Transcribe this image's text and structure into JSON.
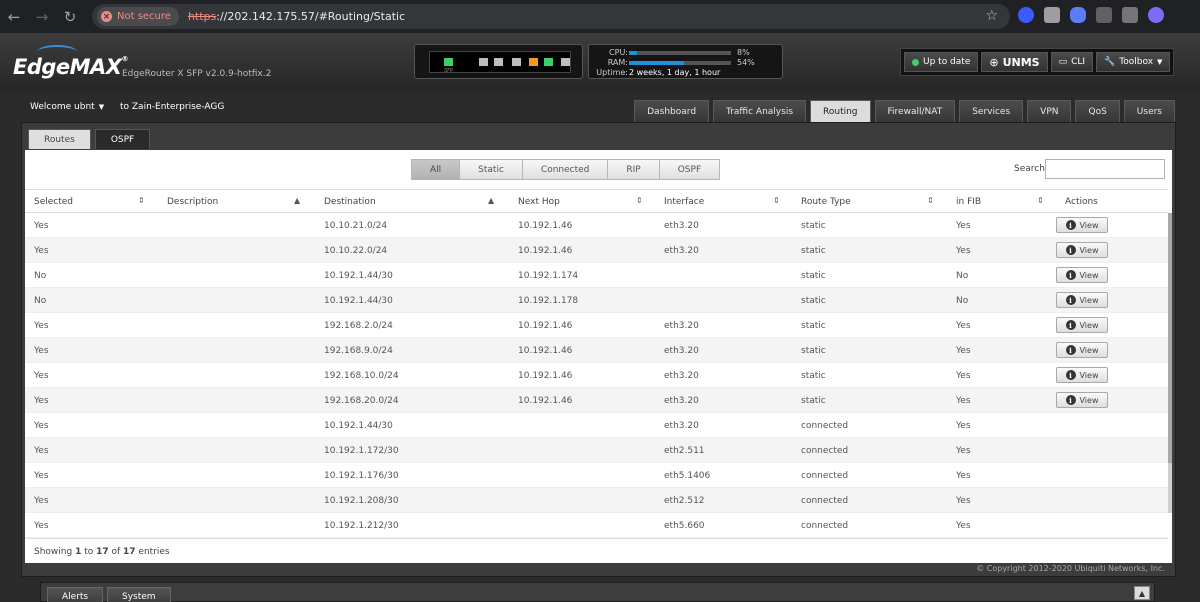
{
  "browser": {
    "security_label": "Not secure",
    "url_scheme": "https",
    "url_rest": "://202.142.175.57/#Routing/Static"
  },
  "header": {
    "logo": "EdgeMAX",
    "version": "EdgeRouter X SFP v2.0.9-hotfix.2",
    "sfp_label": "SFP",
    "cpu_label": "CPU:",
    "cpu_pct": "8%",
    "cpu_value": 8,
    "ram_label": "RAM:",
    "ram_pct": "54%",
    "ram_value": 54,
    "uptime_label": "Uptime:",
    "uptime_value": "2 weeks, 1 day, 1 hour",
    "update_label": "Up to date",
    "unms_label": "UNMS",
    "cli_label": "CLI",
    "toolbox_label": "Toolbox"
  },
  "user": {
    "welcome": "Welcome ubnt",
    "to_name": "to Zain-Enterprise-AGG"
  },
  "main_tabs": [
    {
      "label": "Dashboard"
    },
    {
      "label": "Traffic Analysis"
    },
    {
      "label": "Routing"
    },
    {
      "label": "Firewall/NAT"
    },
    {
      "label": "Services"
    },
    {
      "label": "VPN"
    },
    {
      "label": "QoS"
    },
    {
      "label": "Users"
    }
  ],
  "sub_tabs": [
    {
      "label": "Routes"
    },
    {
      "label": "OSPF"
    }
  ],
  "filters": [
    {
      "label": "All"
    },
    {
      "label": "Static"
    },
    {
      "label": "Connected"
    },
    {
      "label": "RIP"
    },
    {
      "label": "OSPF"
    }
  ],
  "search_label": "Search",
  "columns": {
    "selected": "Selected",
    "description": "Description",
    "destination": "Destination",
    "next_hop": "Next Hop",
    "interface": "Interface",
    "route_type": "Route Type",
    "in_fib": "in FIB",
    "actions": "Actions"
  },
  "view_label": "View",
  "rows": [
    {
      "selected": "Yes",
      "description": "",
      "destination": "10.10.21.0/24",
      "next_hop": "10.192.1.46",
      "interface": "eth3.20",
      "route_type": "static",
      "in_fib": "Yes",
      "view": true
    },
    {
      "selected": "Yes",
      "description": "",
      "destination": "10.10.22.0/24",
      "next_hop": "10.192.1.46",
      "interface": "eth3.20",
      "route_type": "static",
      "in_fib": "Yes",
      "view": true
    },
    {
      "selected": "No",
      "description": "",
      "destination": "10.192.1.44/30",
      "next_hop": "10.192.1.174",
      "interface": "",
      "route_type": "static",
      "in_fib": "No",
      "view": true
    },
    {
      "selected": "No",
      "description": "",
      "destination": "10.192.1.44/30",
      "next_hop": "10.192.1.178",
      "interface": "",
      "route_type": "static",
      "in_fib": "No",
      "view": true
    },
    {
      "selected": "Yes",
      "description": "",
      "destination": "192.168.2.0/24",
      "next_hop": "10.192.1.46",
      "interface": "eth3.20",
      "route_type": "static",
      "in_fib": "Yes",
      "view": true
    },
    {
      "selected": "Yes",
      "description": "",
      "destination": "192.168.9.0/24",
      "next_hop": "10.192.1.46",
      "interface": "eth3.20",
      "route_type": "static",
      "in_fib": "Yes",
      "view": true
    },
    {
      "selected": "Yes",
      "description": "",
      "destination": "192.168.10.0/24",
      "next_hop": "10.192.1.46",
      "interface": "eth3.20",
      "route_type": "static",
      "in_fib": "Yes",
      "view": true
    },
    {
      "selected": "Yes",
      "description": "",
      "destination": "192.168.20.0/24",
      "next_hop": "10.192.1.46",
      "interface": "eth3.20",
      "route_type": "static",
      "in_fib": "Yes",
      "view": true
    },
    {
      "selected": "Yes",
      "description": "",
      "destination": "10.192.1.44/30",
      "next_hop": "",
      "interface": "eth3.20",
      "route_type": "connected",
      "in_fib": "Yes",
      "view": false
    },
    {
      "selected": "Yes",
      "description": "",
      "destination": "10.192.1.172/30",
      "next_hop": "",
      "interface": "eth2.511",
      "route_type": "connected",
      "in_fib": "Yes",
      "view": false
    },
    {
      "selected": "Yes",
      "description": "",
      "destination": "10.192.1.176/30",
      "next_hop": "",
      "interface": "eth5.1406",
      "route_type": "connected",
      "in_fib": "Yes",
      "view": false
    },
    {
      "selected": "Yes",
      "description": "",
      "destination": "10.192.1.208/30",
      "next_hop": "",
      "interface": "eth2.512",
      "route_type": "connected",
      "in_fib": "Yes",
      "view": false
    },
    {
      "selected": "Yes",
      "description": "",
      "destination": "10.192.1.212/30",
      "next_hop": "",
      "interface": "eth5.660",
      "route_type": "connected",
      "in_fib": "Yes",
      "view": false
    }
  ],
  "entries_info": {
    "prefix": "Showing ",
    "start": "1",
    "middle": " to ",
    "end": "17",
    "of": " of ",
    "total": "17",
    "suffix": " entries"
  },
  "copyright": "© Copyright 2012-2020 Ubiquiti Networks, Inc.",
  "bottom_tabs": [
    {
      "label": "Alerts"
    },
    {
      "label": "System"
    }
  ],
  "colors": {
    "accent_blue": "#1e8fd9",
    "status_green": "#3ecf6d",
    "insecure_red": "#f28b82"
  }
}
